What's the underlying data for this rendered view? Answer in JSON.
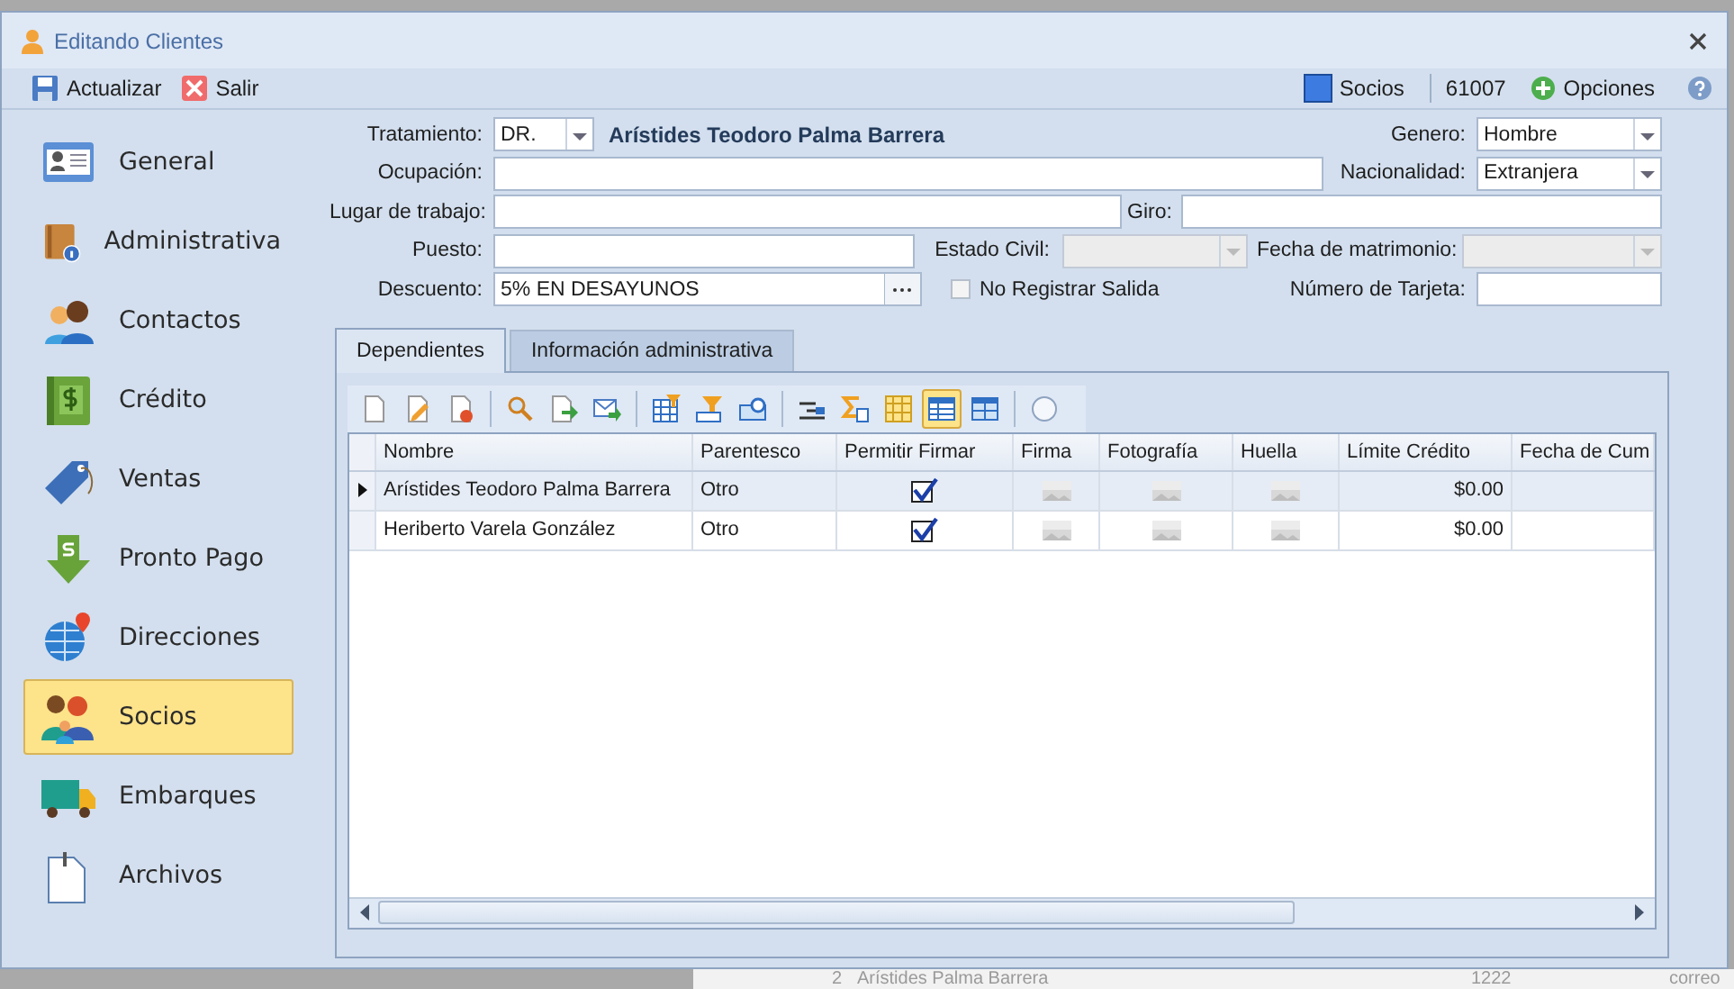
{
  "window": {
    "title": "Editando Clientes"
  },
  "toolbar": {
    "buttons": [
      {
        "kind": "save",
        "label": "Actualizar"
      },
      {
        "kind": "exit",
        "label": "Salir"
      }
    ],
    "section": "Socios",
    "record": "61007",
    "options": "Opciones"
  },
  "sidebar": {
    "items": [
      {
        "kind": "card",
        "label": "General",
        "selected": false
      },
      {
        "kind": "book",
        "label": "Administrativa",
        "selected": false
      },
      {
        "kind": "people",
        "label": "Contactos",
        "selected": false
      },
      {
        "kind": "money",
        "label": "Crédito",
        "selected": false
      },
      {
        "kind": "tag",
        "label": "Ventas",
        "selected": false
      },
      {
        "kind": "arrow",
        "label": "Pronto Pago",
        "selected": false
      },
      {
        "kind": "globe",
        "label": "Direcciones",
        "selected": false
      },
      {
        "kind": "family",
        "label": "Socios",
        "selected": true
      },
      {
        "kind": "truck",
        "label": "Embarques",
        "selected": false
      },
      {
        "kind": "file",
        "label": "Archivos",
        "selected": false
      }
    ]
  },
  "form": {
    "client_name": "Arístides Teodoro Palma Barrera",
    "fields": [
      {
        "label": "Tratamiento:",
        "kind": "combo",
        "value": "DR.",
        "disabled": false
      },
      {
        "label": "Genero:",
        "kind": "combo",
        "value": "Hombre",
        "disabled": false
      },
      {
        "label": "Ocupación:",
        "kind": "input"
      },
      {
        "label": "Nacionalidad:",
        "kind": "combo",
        "value": "Extranjera",
        "disabled": false
      },
      {
        "label": "Lugar de trabajo:",
        "kind": "input"
      },
      {
        "label": "Giro:",
        "kind": "input"
      },
      {
        "label": "Puesto:",
        "kind": "input"
      },
      {
        "label": "Estado Civil:",
        "kind": "combo",
        "disabled": true
      },
      {
        "label": "Fecha de matrimonio:",
        "kind": "combo",
        "disabled": true
      },
      {
        "label": "Descuento:",
        "kind": "browse",
        "value": "5% EN DESAYUNOS"
      },
      {
        "label": "No Registrar Salida",
        "kind": "checkbox",
        "checked": false
      },
      {
        "label": "Número de Tarjeta:",
        "kind": "input"
      }
    ]
  },
  "tabs": [
    {
      "label": "Dependientes",
      "selected": true
    },
    {
      "label": "Información administrativa",
      "selected": false
    }
  ],
  "grid_toolbar": [
    {
      "kind": "new",
      "on": false
    },
    {
      "kind": "edit",
      "on": false
    },
    {
      "kind": "delete",
      "on": false
    },
    {
      "kind": "search",
      "on": false
    },
    {
      "kind": "export",
      "on": false
    },
    {
      "kind": "mail",
      "on": false
    },
    {
      "kind": "tablefilter",
      "on": false
    },
    {
      "kind": "filter",
      "on": false
    },
    {
      "kind": "find",
      "on": false
    },
    {
      "kind": "group",
      "on": false
    },
    {
      "kind": "sum",
      "on": false
    },
    {
      "kind": "columns",
      "on": false
    },
    {
      "kind": "table",
      "on": true
    },
    {
      "kind": "layout",
      "on": false
    },
    {
      "kind": "circle",
      "on": false
    }
  ],
  "table": {
    "columns": [
      "Nombre",
      "Parentesco",
      "Permitir Firmar",
      "Firma",
      "Fotografía",
      "Huella",
      "Límite Crédito",
      "Fecha de Cum"
    ],
    "rows": [
      {
        "selected": true,
        "nombre": "Arístides Teodoro Palma Barrera",
        "parentesco": "Otro",
        "permitir_firmar": true,
        "limite": "$0.00"
      },
      {
        "selected": false,
        "nombre": "Heriberto Varela González",
        "parentesco": "Otro",
        "permitir_firmar": true,
        "limite": "$0.00"
      }
    ]
  },
  "background_window": {
    "texts": [
      "2",
      "Arístides Palma Barrera",
      "1222",
      "correo"
    ]
  }
}
